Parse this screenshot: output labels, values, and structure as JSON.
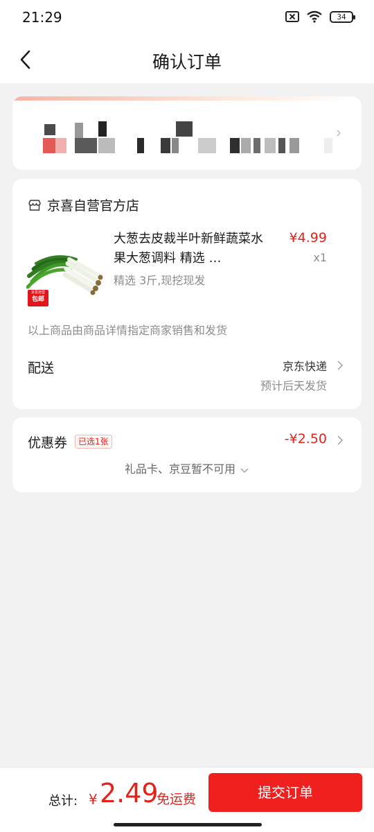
{
  "status_bar": {
    "time": "21:29",
    "battery": "34"
  },
  "header": {
    "title": "确认订单"
  },
  "store": {
    "name": "京喜自营官方店",
    "product": {
      "title": "大葱去皮裁半叶新鲜蔬菜水果大葱调料 精选 …",
      "spec": "精选 3斤,现挖现发",
      "price": "¥4.99",
      "qty": "x1",
      "badge_top": "京喜自营",
      "badge_bottom": "包邮"
    },
    "seller_note": "以上商品由商品详情指定商家销售和发货",
    "delivery": {
      "label": "配送",
      "method": "京东快递",
      "eta": "预计后天发货"
    }
  },
  "coupon": {
    "label": "优惠券",
    "tag": "已选1张",
    "amount": "-¥2.50",
    "unavailable": "礼品卡、京豆暂不可用"
  },
  "footer": {
    "total_label": "总计:",
    "currency": "¥",
    "total": "2.49",
    "free_shipping": "免运费",
    "submit": "提交订单"
  },
  "colors": {
    "accent": "#e2231a",
    "button": "#f0201e",
    "background": "#f2f2f2"
  },
  "icons": [
    "back-arrow-icon",
    "wifi-icon",
    "sim-icon",
    "battery-icon",
    "store-icon",
    "chevron-right-icon",
    "chevron-down-icon"
  ]
}
